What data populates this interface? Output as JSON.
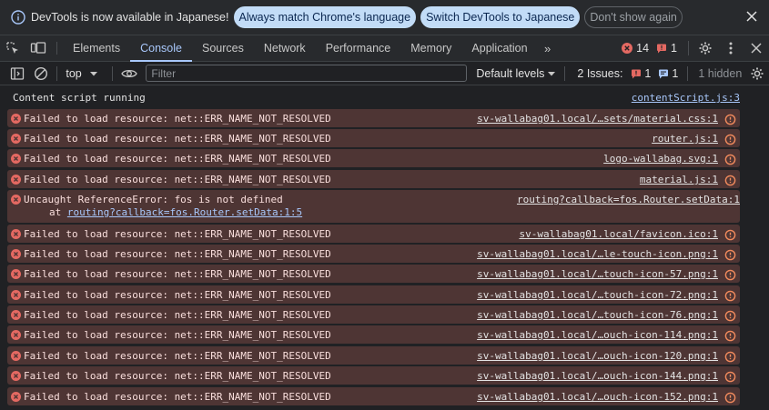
{
  "infobar": {
    "message": "DevTools is now available in Japanese!",
    "match_button": "Always match Chrome's language",
    "switch_button": "Switch DevTools to Japanese",
    "dismiss_button": "Don't show again",
    "close_icon": "close-icon"
  },
  "tabs": [
    {
      "label": "Elements"
    },
    {
      "label": "Console"
    },
    {
      "label": "Sources"
    },
    {
      "label": "Network"
    },
    {
      "label": "Performance"
    },
    {
      "label": "Memory"
    },
    {
      "label": "Application"
    }
  ],
  "toolbar": {
    "more_tabs": "»",
    "error_count": "14",
    "issue_count": "1"
  },
  "console_toolbar": {
    "context": "top",
    "filter_placeholder": "Filter",
    "levels": "Default levels",
    "issues_label": "2 Issues:",
    "issues_error": "1",
    "issues_info": "1",
    "hidden": "1 hidden"
  },
  "messages": [
    {
      "type": "info",
      "text": "Content script running",
      "source": "contentScript.js:3"
    },
    {
      "type": "error",
      "text": "Failed to load resource: net::ERR_NAME_NOT_RESOLVED",
      "source": "sv-wallabag01.local/…sets/material.css:1"
    },
    {
      "type": "error",
      "text": "Failed to load resource: net::ERR_NAME_NOT_RESOLVED",
      "source": "router.js:1"
    },
    {
      "type": "error",
      "text": "Failed to load resource: net::ERR_NAME_NOT_RESOLVED",
      "source": "logo-wallabag.svg:1"
    },
    {
      "type": "error",
      "text": "Failed to load resource: net::ERR_NAME_NOT_RESOLVED",
      "source": "material.js:1"
    },
    {
      "type": "error",
      "text": "Uncaught ReferenceError: fos is not defined",
      "at_prefix": "at ",
      "at_link": "routing?callback=fos.Router.setData:1:5",
      "source": "routing?callback=fos.Router.setData:1"
    },
    {
      "type": "error",
      "text": "Failed to load resource: net::ERR_NAME_NOT_RESOLVED",
      "source": "sv-wallabag01.local/favicon.ico:1"
    },
    {
      "type": "error",
      "text": "Failed to load resource: net::ERR_NAME_NOT_RESOLVED",
      "source": "sv-wallabag01.local/…le-touch-icon.png:1"
    },
    {
      "type": "error",
      "text": "Failed to load resource: net::ERR_NAME_NOT_RESOLVED",
      "source": "sv-wallabag01.local/…touch-icon-57.png:1"
    },
    {
      "type": "error",
      "text": "Failed to load resource: net::ERR_NAME_NOT_RESOLVED",
      "source": "sv-wallabag01.local/…touch-icon-72.png:1"
    },
    {
      "type": "error",
      "text": "Failed to load resource: net::ERR_NAME_NOT_RESOLVED",
      "source": "sv-wallabag01.local/…touch-icon-76.png:1"
    },
    {
      "type": "error",
      "text": "Failed to load resource: net::ERR_NAME_NOT_RESOLVED",
      "source": "sv-wallabag01.local/…ouch-icon-114.png:1"
    },
    {
      "type": "error",
      "text": "Failed to load resource: net::ERR_NAME_NOT_RESOLVED",
      "source": "sv-wallabag01.local/…ouch-icon-120.png:1"
    },
    {
      "type": "error",
      "text": "Failed to load resource: net::ERR_NAME_NOT_RESOLVED",
      "source": "sv-wallabag01.local/…ouch-icon-144.png:1"
    },
    {
      "type": "error",
      "text": "Failed to load resource: net::ERR_NAME_NOT_RESOLVED",
      "source": "sv-wallabag01.local/…ouch-icon-152.png:1"
    }
  ],
  "colors": {
    "accent": "#a8c7fa",
    "error": "#e46962",
    "error_row_bg": "#4e3534",
    "ai_icon": "#f28b5d"
  }
}
